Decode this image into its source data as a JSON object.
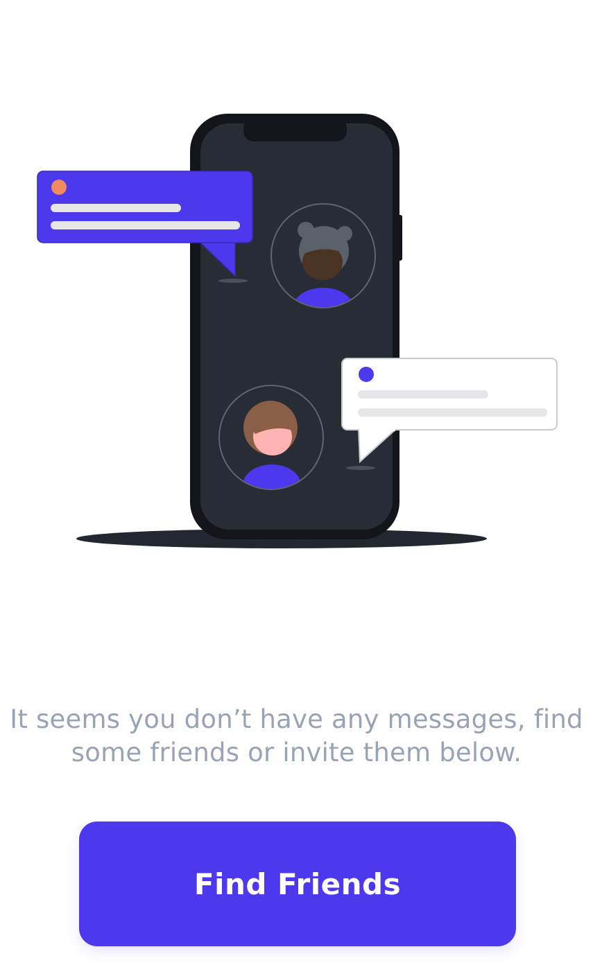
{
  "empty_state": {
    "message_line_1": "It seems you don’t have any messages, find",
    "message_line_2": "some friends or invite them below.",
    "illustration": {
      "phone_icon": "phone-icon",
      "avatar_icons": [
        "female-avatar-icon",
        "male-avatar-icon"
      ],
      "bubble_icons": [
        "chat-bubble-icon",
        "chat-bubble-icon"
      ]
    }
  },
  "actions": {
    "find_friends_label": "Find Friends"
  },
  "colors": {
    "accent": "#4c38ed",
    "phone_body": "#13151a",
    "phone_screen": "#282c34",
    "message_text": "#98a3b6",
    "notification_orange": "#ef8b5f",
    "skin_light": "#ffb3b3",
    "hair_brown": "#8b5e48",
    "skin_dark": "#4b3324",
    "hair_gray": "#5a6169"
  }
}
